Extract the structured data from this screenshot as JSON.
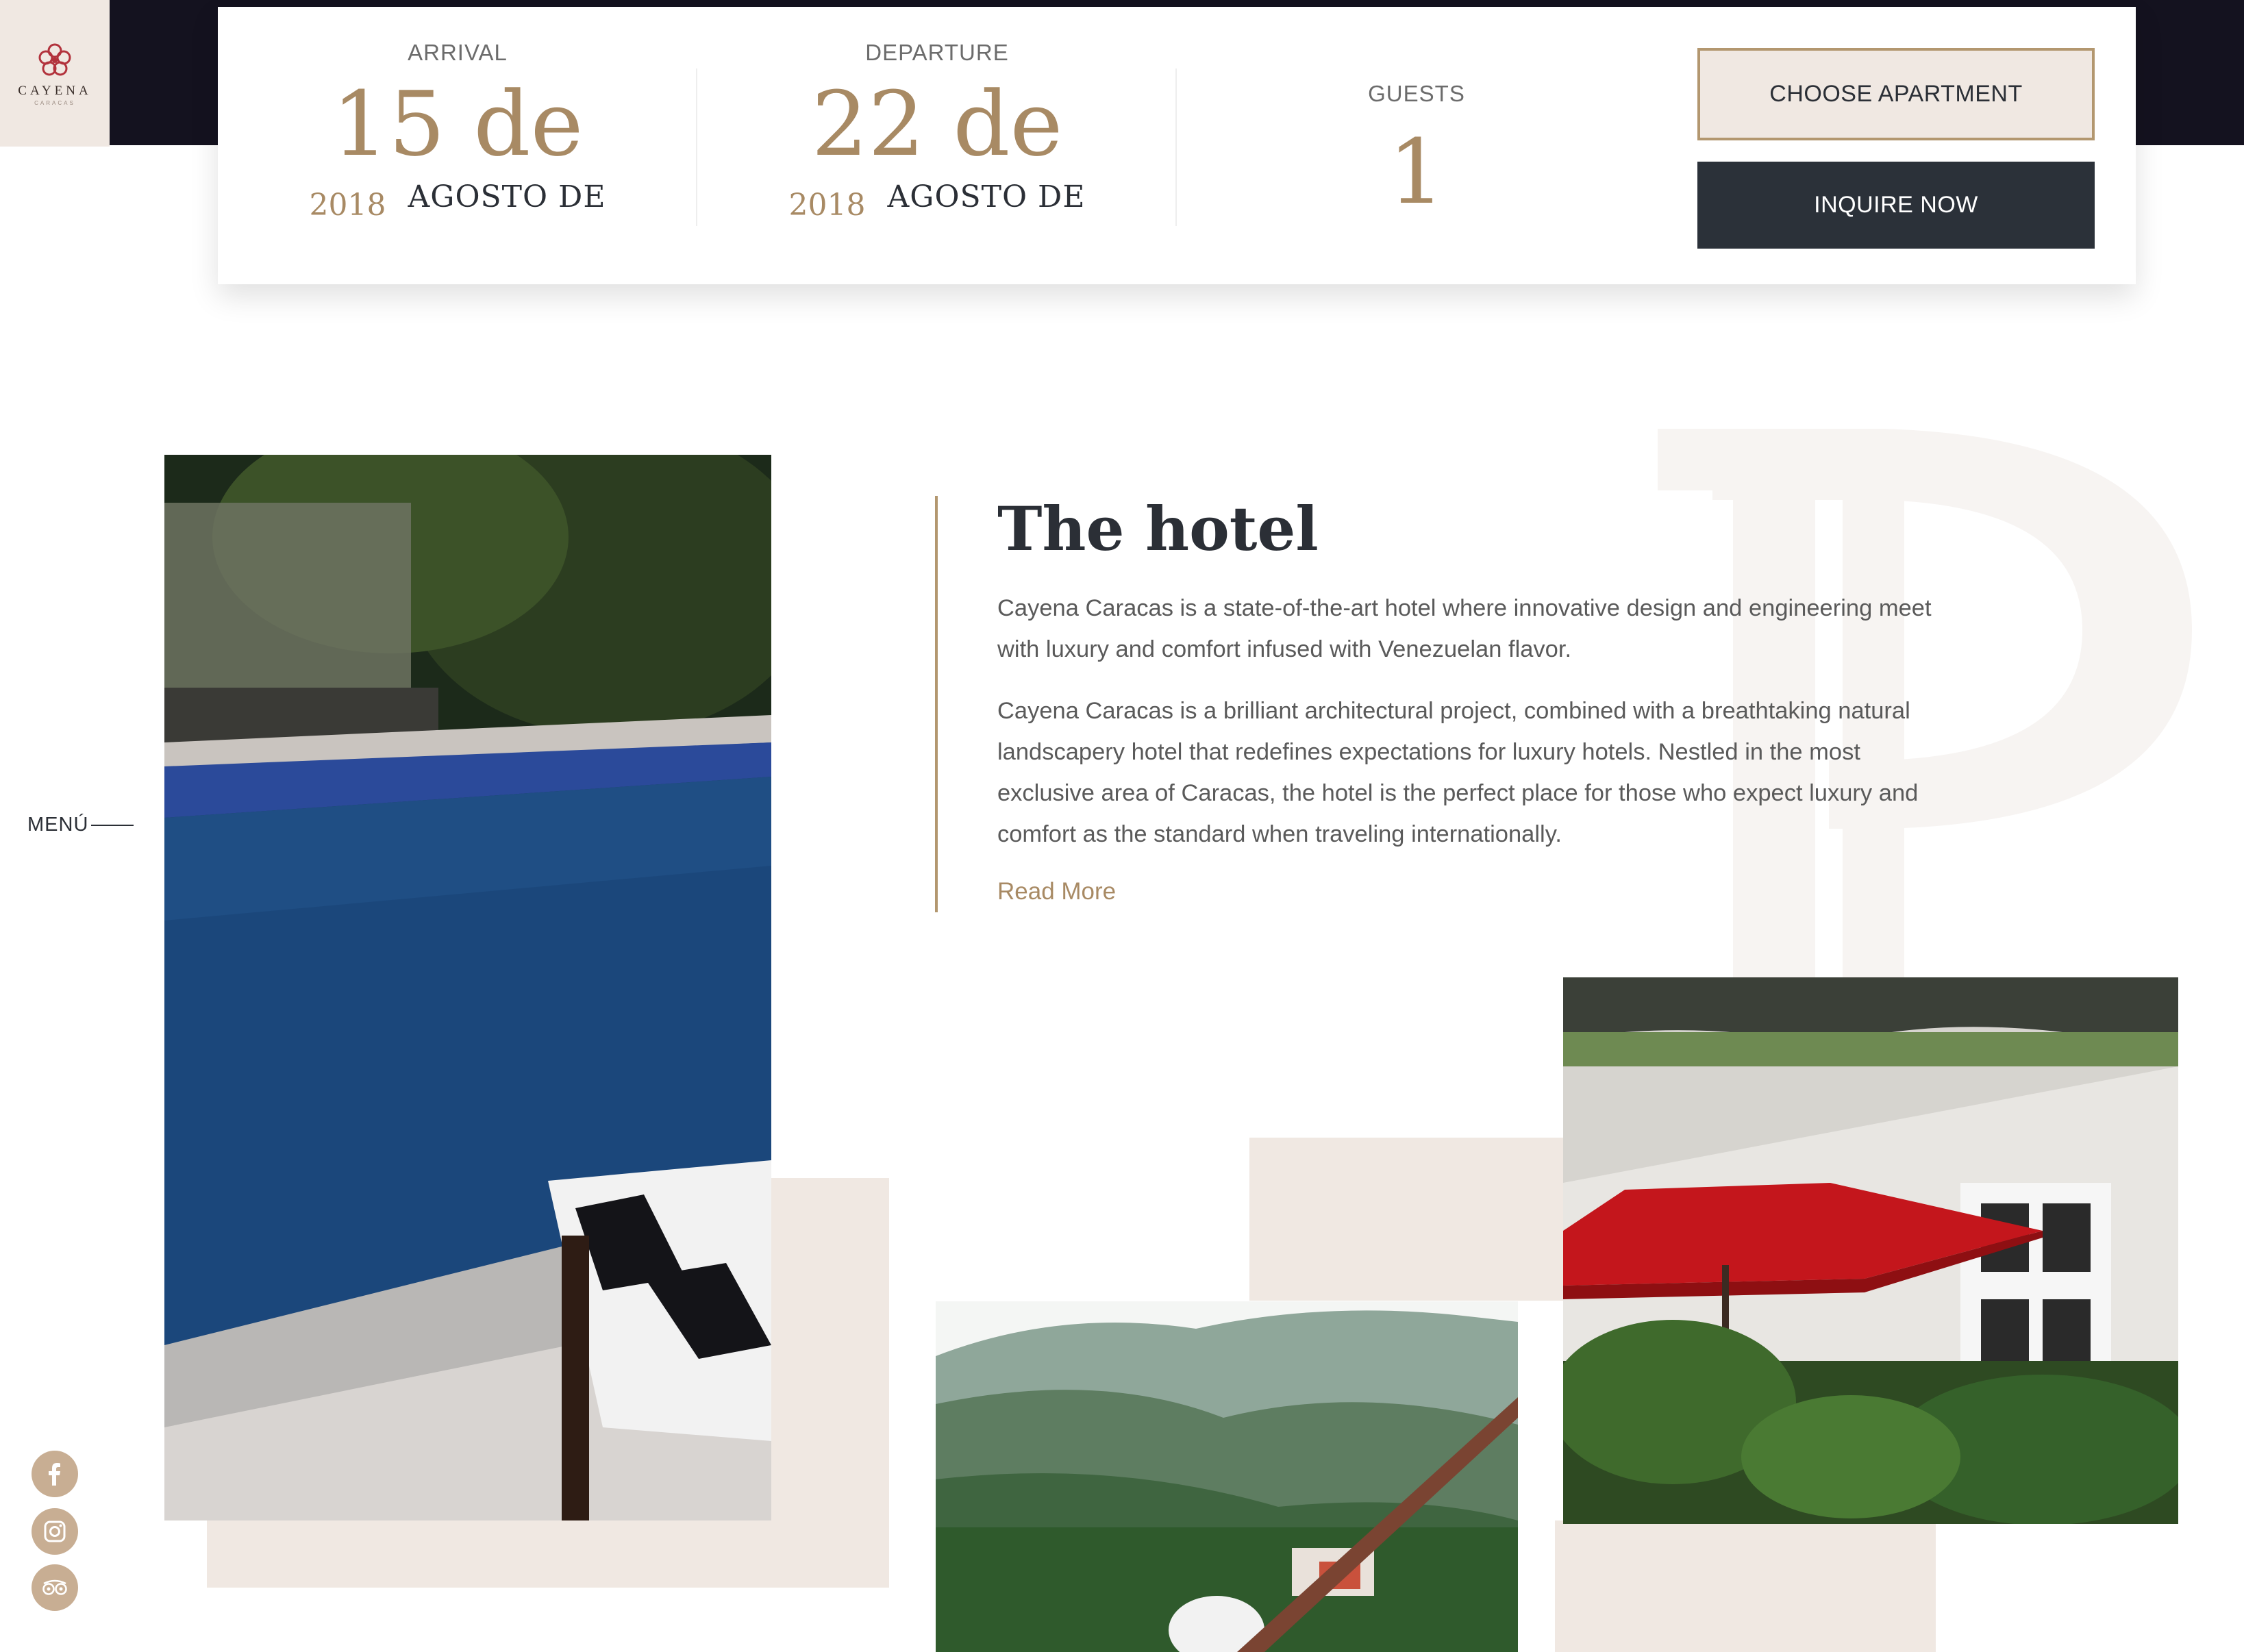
{
  "brand": {
    "name": "CAYENA",
    "sub": "CARACAS"
  },
  "booking": {
    "arrival": {
      "label": "ARRIVAL",
      "day": "15 de",
      "year": "2018",
      "month": "AGOSTO DE"
    },
    "departure": {
      "label": "DEPARTURE",
      "day": "22 de",
      "year": "2018",
      "month": "AGOSTO DE"
    },
    "guests": {
      "label": "GUESTS",
      "count": "1"
    },
    "choose_label": "CHOOSE APARTMENT",
    "inquire_label": "INQUIRE NOW"
  },
  "nav": {
    "menu_label": "MENÚ"
  },
  "social": [
    {
      "icon": "facebook-icon"
    },
    {
      "icon": "instagram-icon"
    },
    {
      "icon": "tripadvisor-icon"
    }
  ],
  "hotel": {
    "title": "The hotel",
    "paragraph1": "Cayena Caracas is a state-of-the-art hotel where innovative design and engineering meet with luxury and comfort infused with Venezuelan flavor.",
    "paragraph2": "Cayena Caracas is a brilliant architectural project, combined with a breathtaking natural landscapery hotel that redefines expectations for luxury hotels. Nestled in the most exclusive area of Caracas, the hotel is the perfect place for those who expect luxury and comfort as the standard when traveling internationally.",
    "read_more": "Read More"
  },
  "colors": {
    "accent_gold": "#a88a64",
    "beige": "#f0e8e2",
    "dark": "#2b3139",
    "top_band": "#14121f"
  }
}
